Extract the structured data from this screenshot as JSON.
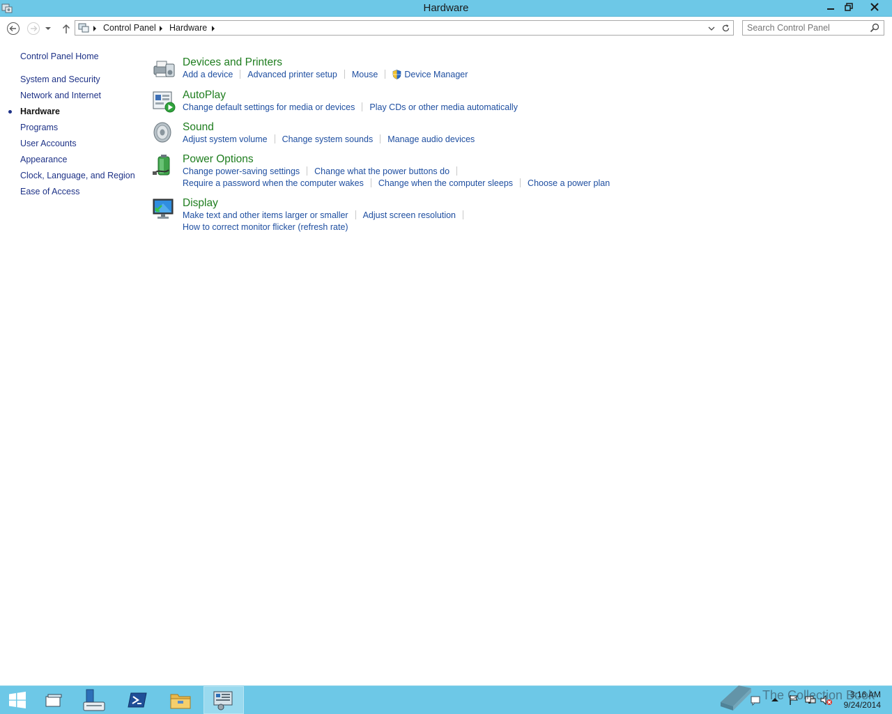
{
  "window": {
    "title": "Hardware"
  },
  "address": {
    "crumbs": [
      "Control Panel",
      "Hardware"
    ],
    "search_placeholder": "Search Control Panel"
  },
  "sidebar": {
    "items": [
      {
        "label": "Control Panel Home"
      },
      {
        "label": "System and Security"
      },
      {
        "label": "Network and Internet"
      },
      {
        "label": "Hardware",
        "current": true
      },
      {
        "label": "Programs"
      },
      {
        "label": "User Accounts"
      },
      {
        "label": "Appearance"
      },
      {
        "label": "Clock, Language, and Region"
      },
      {
        "label": "Ease of Access"
      }
    ]
  },
  "categories": [
    {
      "title": "Devices and Printers",
      "icon": "devices-printers-icon",
      "links": [
        "Add a device",
        "Advanced printer setup",
        "Mouse",
        "Device Manager"
      ]
    },
    {
      "title": "AutoPlay",
      "icon": "autoplay-icon",
      "links": [
        "Change default settings for media or devices",
        "Play CDs or other media automatically"
      ]
    },
    {
      "title": "Sound",
      "icon": "speaker-icon",
      "links": [
        "Adjust system volume",
        "Change system sounds",
        "Manage audio devices"
      ]
    },
    {
      "title": "Power Options",
      "icon": "battery-icon",
      "links": [
        "Change power-saving settings",
        "Change what the power buttons do",
        "Require a password when the computer wakes",
        "Change when the computer sleeps",
        "Choose a power plan"
      ]
    },
    {
      "title": "Display",
      "icon": "monitor-icon",
      "links": [
        "Make text and other items larger or smaller",
        "Adjust screen resolution",
        "How to correct monitor flicker (refresh rate)"
      ]
    }
  ],
  "taskbar": {
    "clock_time": "3:16 AM",
    "clock_date": "9/24/2014",
    "watermark": "The Collection Book"
  },
  "colors": {
    "titlebar": "#6dc8e7",
    "link": "#1e4ea0",
    "category_title": "#1e7d1e"
  }
}
